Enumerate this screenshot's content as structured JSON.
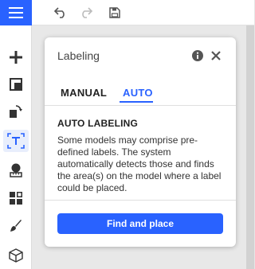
{
  "topbar": {
    "menu_icon": "hamburger-icon",
    "undo_icon": "undo-icon",
    "redo_icon": "redo-icon",
    "save_icon": "save-icon"
  },
  "sidebar": {
    "items": [
      {
        "icon": "plus-icon"
      },
      {
        "icon": "layout-icon"
      },
      {
        "icon": "transform-icon"
      },
      {
        "icon": "text-label-icon",
        "active": true
      },
      {
        "icon": "measure-icon"
      },
      {
        "icon": "grid-icon"
      },
      {
        "icon": "brush-icon"
      },
      {
        "icon": "cube-icon"
      }
    ]
  },
  "panel": {
    "title": "Labeling",
    "info_icon": "info-icon",
    "close_icon": "close-icon",
    "tabs": [
      {
        "label": "MANUAL",
        "active": false
      },
      {
        "label": "AUTO",
        "active": true
      }
    ],
    "section_title": "AUTO LABELING",
    "description": "Some models may comprise pre-defined labels. The system automatically detects those and finds the area(s) on the model where a label could be placed.",
    "primary_button": "Find and place"
  },
  "colors": {
    "accent": "#2962ff",
    "active_tab": "#2962ff"
  }
}
